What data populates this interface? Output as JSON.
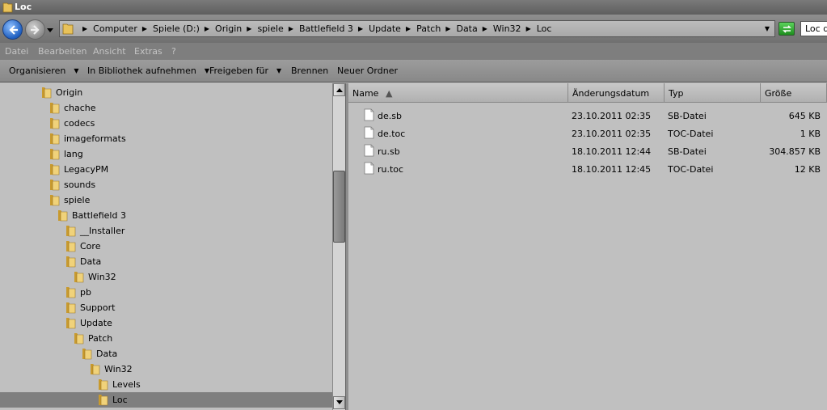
{
  "window": {
    "title": "Loc"
  },
  "address": {
    "crumbs": [
      "Computer",
      "Spiele (D:)",
      "Origin",
      "spiele",
      "Battlefield 3",
      "Update",
      "Patch",
      "Data",
      "Win32",
      "Loc"
    ],
    "search_text": "Loc d"
  },
  "menu": [
    "Datei",
    "Bearbeiten",
    "Ansicht",
    "Extras",
    "?"
  ],
  "commands": {
    "organize": "Organisieren",
    "include_library": "In Bibliothek aufnehmen",
    "share": "Freigeben für",
    "burn": "Brennen",
    "new_folder": "Neuer Ordner"
  },
  "tree": [
    {
      "label": "Origin",
      "level": 0
    },
    {
      "label": "chache",
      "level": 1
    },
    {
      "label": "codecs",
      "level": 1
    },
    {
      "label": "imageformats",
      "level": 1
    },
    {
      "label": "lang",
      "level": 1
    },
    {
      "label": "LegacyPM",
      "level": 1
    },
    {
      "label": "sounds",
      "level": 1
    },
    {
      "label": "spiele",
      "level": 1
    },
    {
      "label": "Battlefield 3",
      "level": 2
    },
    {
      "label": "__Installer",
      "level": 3
    },
    {
      "label": "Core",
      "level": 3
    },
    {
      "label": "Data",
      "level": 3
    },
    {
      "label": "Win32",
      "level": 4
    },
    {
      "label": "pb",
      "level": 3
    },
    {
      "label": "Support",
      "level": 3
    },
    {
      "label": "Update",
      "level": 3
    },
    {
      "label": "Patch",
      "level": 4
    },
    {
      "label": "Data",
      "level": 5
    },
    {
      "label": "Win32",
      "level": 6
    },
    {
      "label": "Levels",
      "level": 7
    },
    {
      "label": "Loc",
      "level": 7,
      "selected": true
    }
  ],
  "columns": {
    "name": "Name",
    "date": "Änderungsdatum",
    "type": "Typ",
    "size": "Größe"
  },
  "files": [
    {
      "name": "de.sb",
      "date": "23.10.2011 02:35",
      "type": "SB-Datei",
      "size": "645 KB"
    },
    {
      "name": "de.toc",
      "date": "23.10.2011 02:35",
      "type": "TOC-Datei",
      "size": "1 KB"
    },
    {
      "name": "ru.sb",
      "date": "18.10.2011 12:44",
      "type": "SB-Datei",
      "size": "304.857 KB"
    },
    {
      "name": "ru.toc",
      "date": "18.10.2011 12:45",
      "type": "TOC-Datei",
      "size": "12 KB"
    }
  ]
}
